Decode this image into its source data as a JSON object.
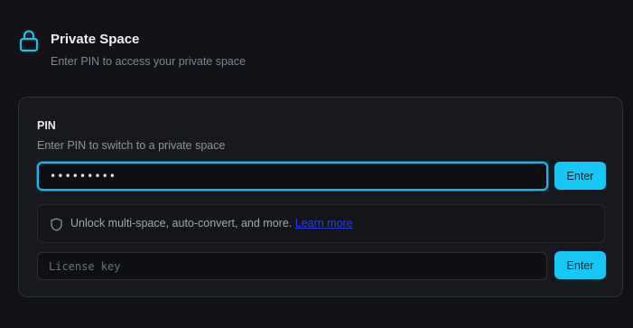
{
  "header": {
    "title": "Private Space",
    "subtitle": "Enter PIN to access your private space",
    "icon": "lock-icon"
  },
  "pin": {
    "label": "PIN",
    "description": "Enter PIN to switch to a private space",
    "value": "•••••••••",
    "button_label": "Enter"
  },
  "notice": {
    "icon": "shield-icon",
    "text": "Unlock multi-space, auto-convert, and more. ",
    "link_label": "Learn more"
  },
  "license": {
    "placeholder": "License key",
    "value": "",
    "button_label": "Enter"
  },
  "colors": {
    "accent": "#14c8f3",
    "background": "#111217",
    "card": "#18191e",
    "link": "#2a3fe0"
  }
}
